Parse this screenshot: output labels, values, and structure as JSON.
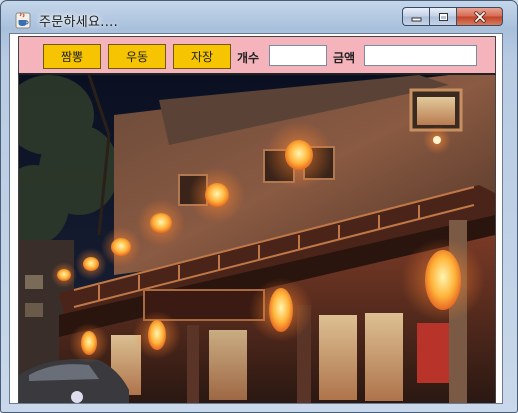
{
  "window": {
    "title": "주문하세요....",
    "app_icon": "java-cup-icon",
    "controls": [
      "minimize-icon",
      "maximize-icon",
      "close-icon"
    ]
  },
  "toolbar": {
    "background_color": "#f5b3bc",
    "button_color": "#f6c400",
    "buttons": [
      {
        "label": "짬뽕"
      },
      {
        "label": "우동"
      },
      {
        "label": "자장"
      }
    ],
    "count_label": "개수",
    "count_value": "",
    "amount_label": "금액",
    "amount_value": ""
  },
  "photo": {
    "subject": "night-restaurant-with-lanterns-image"
  }
}
